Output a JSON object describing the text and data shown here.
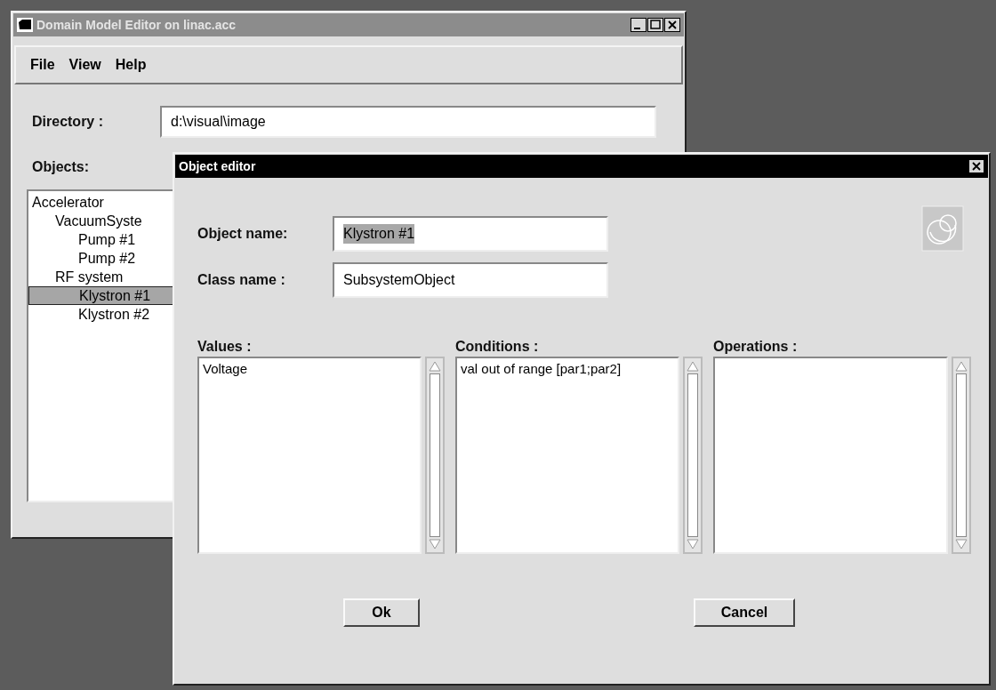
{
  "main_window": {
    "title": "Domain Model Editor on linac.acc",
    "active": false,
    "menu": [
      "File",
      "View",
      "Help"
    ],
    "directory": {
      "label": "Directory :",
      "value": "d:\\visual\\image"
    },
    "objects": {
      "label": "Objects:",
      "tree": [
        {
          "label": "Accelerator",
          "selected": false,
          "children": [
            {
              "label": "VacuumSyste",
              "selected": false,
              "children": [
                {
                  "label": "Pump #1",
                  "selected": false
                },
                {
                  "label": "Pump #2",
                  "selected": false
                }
              ]
            },
            {
              "label": "RF system",
              "selected": false,
              "children": [
                {
                  "label": "Klystron #1",
                  "selected": true
                },
                {
                  "label": "Klystron #2",
                  "selected": false
                }
              ]
            }
          ]
        }
      ]
    }
  },
  "dialog": {
    "title": "Object editor",
    "active": true,
    "object_name": {
      "label": "Object name:",
      "value": "Klystron #1",
      "text_selected": true
    },
    "class_name": {
      "label": "Class name :",
      "value": "SubsystemObject",
      "text_selected": false
    },
    "lists": [
      {
        "label": "Values :",
        "items": [
          "Voltage"
        ]
      },
      {
        "label": "Conditions :",
        "items": [
          "val out of range [par1;par2]"
        ]
      },
      {
        "label": "Operations :"
      }
    ],
    "buttons": [
      "Ok",
      "Cancel"
    ]
  }
}
